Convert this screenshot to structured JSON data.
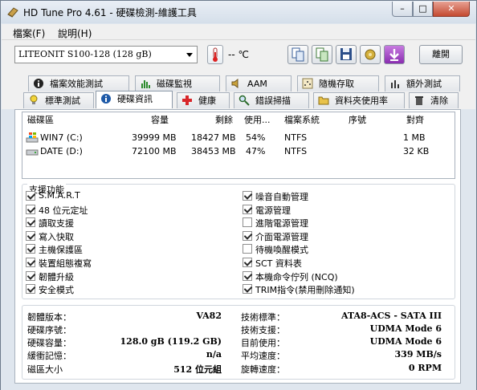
{
  "window": {
    "title": "HD Tune Pro 4.61 - 硬碟檢測-維護工具",
    "min": "–",
    "max": "□",
    "close": "✕"
  },
  "menu": [
    {
      "label": "檔案(F)"
    },
    {
      "label": "說明(H)"
    }
  ],
  "toolbar": {
    "drive": "LITEONIT S100-128        (128 gB)",
    "temperature": "-- ℃",
    "exit_label": "離開"
  },
  "tabs_row1": [
    "檔案效能測試",
    "磁碟監視",
    "AAM",
    "隨機存取",
    "額外測試"
  ],
  "tabs_row2": [
    "標準測試",
    "硬碟資訊",
    "健康",
    "錯誤掃描",
    "資料夾使用率",
    "清除"
  ],
  "partitions": {
    "headers": [
      "磁碟區",
      "容量",
      "剩餘",
      "使用...",
      "檔案系統",
      "序號",
      "對齊"
    ],
    "rows": [
      {
        "name": "WIN7 (C:)",
        "capacity": "39999 MB",
        "free": "18427 MB",
        "used": "54%",
        "fs": "NTFS",
        "serial": "",
        "align": "1 MB"
      },
      {
        "name": "DATE (D:)",
        "capacity": "72100 MB",
        "free": "38453 MB",
        "used": "47%",
        "fs": "NTFS",
        "serial": "",
        "align": "32 KB"
      }
    ]
  },
  "features": {
    "title": "支援功能",
    "left": [
      {
        "label": "S.M.A.R.T",
        "checked": true
      },
      {
        "label": "48 位元定址",
        "checked": true
      },
      {
        "label": "讀取支援",
        "checked": true
      },
      {
        "label": "寫入快取",
        "checked": true
      },
      {
        "label": "主機保護區",
        "checked": true
      },
      {
        "label": "裝置組態複寫",
        "checked": true
      },
      {
        "label": "韌體升級",
        "checked": true
      },
      {
        "label": "安全模式",
        "checked": true
      }
    ],
    "right": [
      {
        "label": "噪音自動管理",
        "checked": true
      },
      {
        "label": "電源管理",
        "checked": true
      },
      {
        "label": "進階電源管理",
        "checked": false
      },
      {
        "label": "介面電源管理",
        "checked": true
      },
      {
        "label": "待機喚醒模式",
        "checked": false
      },
      {
        "label": "SCT 資料表",
        "checked": true
      },
      {
        "label": "本機命令佇列 (NCQ)",
        "checked": true
      },
      {
        "label": "TRIM指令(禁用刪除通知)",
        "checked": true
      }
    ]
  },
  "info": {
    "left": [
      {
        "label": "韌體版本：",
        "value": "VA82"
      },
      {
        "label": "硬碟序號：",
        "value": ""
      },
      {
        "label": "硬碟容量：",
        "value": "128.0 gB (119.2 GB)"
      },
      {
        "label": "緩衝記憶：",
        "value": "n/a"
      },
      {
        "label": "磁區大小",
        "value": "512 位元組"
      }
    ],
    "right": [
      {
        "label": "技術標準：",
        "value": "ATA8-ACS - SATA III"
      },
      {
        "label": "技術支援：",
        "value": "UDMA Mode 6"
      },
      {
        "label": "目前使用：",
        "value": "UDMA Mode 6"
      },
      {
        "label": "平均速度：",
        "value": "339 MB/s"
      },
      {
        "label": "旋轉速度：",
        "value": "0 RPM"
      }
    ]
  }
}
